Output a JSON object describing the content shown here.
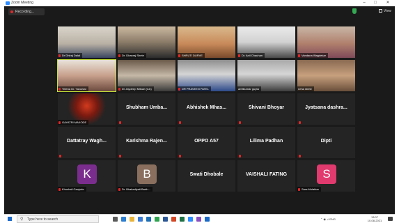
{
  "window": {
    "title": "Zoom Meeting"
  },
  "topbar": {
    "recording_label": "Recording...",
    "view_label": "View"
  },
  "tiles": [
    {
      "name": "Dr Dhiraj Dalal",
      "kind": "video",
      "video_bg": "linear-gradient(180deg,#d9d4cb 0%,#b9b1a4 55%,#3b4660 100%)"
    },
    {
      "name": "Dr. Dhanraj Shete",
      "kind": "video",
      "video_bg": "linear-gradient(180deg,#cbb8a0 0%,#8a7b68 50%,#2c2c2c 100%)"
    },
    {
      "name": "SHRUTI DURVE",
      "kind": "video",
      "video_bg": "linear-gradient(180deg,#d9b98c 0%,#c88a5a 55%,#7a4a2c 100%)"
    },
    {
      "name": "Dr. Anil Chauhan",
      "kind": "video",
      "video_bg": "linear-gradient(180deg,#eaeaea 0%,#d2d2d2 50%,#4a4a4a 100%)"
    },
    {
      "name": "Vandana Wagdekar",
      "kind": "video",
      "video_bg": "linear-gradient(180deg,#c9b6a6 0%,#b07f6c 55%,#7f4a5a 100%)"
    },
    {
      "name": "Yelena Dr. Yavurkar",
      "kind": "video",
      "active": true,
      "video_bg": "linear-gradient(180deg,#e9e3da 0%,#c8a08c 50%,#6c4a3e 100%)"
    },
    {
      "name": "Dr Jaydeep Mitkari (CA)",
      "kind": "video",
      "video_bg": "linear-gradient(180deg,#6b5a4a 0%,#c5b8a6 50%,#3a3a3a 100%)"
    },
    {
      "name": "DR PRAVEEN PATEL",
      "kind": "video",
      "video_bg": "linear-gradient(180deg,#8e8e8e 0%,#d5d5d5 45%,#2d4a8a 100%)"
    },
    {
      "name": "amitkumar gupta",
      "kind": "video",
      "no_mute": true,
      "video_bg": "linear-gradient(180deg,#a9a9a9 0%,#d6d6d6 45%,#3d3d3d 100%)"
    },
    {
      "name": "neha shete",
      "kind": "video",
      "no_mute": true,
      "video_bg": "linear-gradient(180deg,#8a6a52 0%,#c7a07e 50%,#6a4e3a 100%)"
    },
    {
      "name": "GAYATRI MAKODE",
      "kind": "video",
      "video_bg": "radial-gradient(circle at 50% 40%,#d23a1e 0%,#7a1a10 30%,#242424 55%)"
    },
    {
      "name": "Shubham Umba...",
      "kind": "text"
    },
    {
      "name": "Abhishek Mhas...",
      "kind": "text"
    },
    {
      "name": "Shivani Bhoyar",
      "kind": "text"
    },
    {
      "name": "Jyatsana dashra...",
      "kind": "text"
    },
    {
      "name": "Dattatray Wagh...",
      "kind": "text"
    },
    {
      "name": "Karishma Rajen...",
      "kind": "text"
    },
    {
      "name": "OPPO A57",
      "kind": "text"
    },
    {
      "name": "Lilima Padhan",
      "kind": "text"
    },
    {
      "name": "Dipti",
      "kind": "text"
    },
    {
      "name": "Khushali Gaujude",
      "kind": "avatar",
      "letter": "K",
      "color": "#7b2d8e"
    },
    {
      "name": "Dr. Bhakadiyati Barth...",
      "kind": "avatar",
      "letter": "B",
      "color": "#8a6f5e"
    },
    {
      "name": "Swati Dhobale",
      "kind": "text",
      "no_mute": true
    },
    {
      "name": "VAISHALI FATING",
      "kind": "text",
      "no_mute": true
    },
    {
      "name": "Sara Mulatkar",
      "kind": "avatar",
      "letter": "S",
      "color": "#e03a6e"
    }
  ],
  "taskbar": {
    "search_placeholder": "Type here to search",
    "lang": "ENG",
    "time": "13:07",
    "date": "10-08-2021",
    "apps": [
      {
        "icon": "task-view-icon",
        "color": "#5a5a5a"
      },
      {
        "icon": "edge-icon",
        "color": "#2f7fd0"
      },
      {
        "icon": "file-explorer-icon",
        "color": "#e8b43a"
      },
      {
        "icon": "store-icon",
        "color": "#3a7bd5"
      },
      {
        "icon": "mail-icon",
        "color": "#1f6fb5"
      },
      {
        "icon": "chrome-icon",
        "color": "#2ea44f"
      },
      {
        "icon": "word-icon",
        "color": "#2b5797"
      },
      {
        "icon": "powerpoint-icon",
        "color": "#d24726"
      },
      {
        "icon": "excel-icon",
        "color": "#1e7145"
      },
      {
        "icon": "zoom-icon",
        "color": "#2d8cff"
      },
      {
        "icon": "photos-icon",
        "color": "#8a4fc1"
      },
      {
        "icon": "settings-icon",
        "color": "#1b6ac9"
      }
    ]
  }
}
